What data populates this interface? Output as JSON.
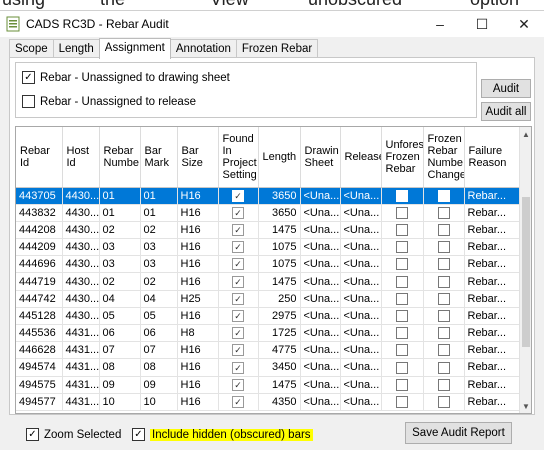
{
  "top_snip": [
    "using",
    "the",
    "View",
    "unobscured",
    "option"
  ],
  "window": {
    "title": "CADS RC3D - Rebar Audit",
    "minimize": "–",
    "maximize": "☐",
    "close": "✕"
  },
  "tabs": [
    "Scope",
    "Length",
    "Assignment",
    "Annotation",
    "Frozen Rebar"
  ],
  "active_tab": "Assignment",
  "options": {
    "unassigned_sheet_label": "Rebar - Unassigned to drawing sheet",
    "unassigned_sheet_checked": true,
    "unassigned_release_label": "Rebar - Unassigned to release",
    "unassigned_release_checked": false
  },
  "buttons": {
    "audit": "Audit",
    "audit_all": "Audit all",
    "save_report": "Save Audit Report"
  },
  "grid": {
    "columns": [
      "Rebar Id",
      "Host Id",
      "Rebar Numbe",
      "Bar Mark",
      "Bar Size",
      "Found In Project Setting",
      "Length",
      "Drawin Sheet",
      "Release",
      "Unfores Frozen Rebar",
      "Frozen Rebar Numbe Change",
      "Failure Reason"
    ],
    "rows": [
      {
        "rebar_id": "443705",
        "host_id": "4430...",
        "rebar_number": "01",
        "bar_mark": "01",
        "bar_size": "H16",
        "length": "3650",
        "sheet": "<Una...",
        "release": "<Una...",
        "reason": "Rebar..."
      },
      {
        "rebar_id": "443832",
        "host_id": "4430...",
        "rebar_number": "01",
        "bar_mark": "01",
        "bar_size": "H16",
        "length": "3650",
        "sheet": "<Una...",
        "release": "<Una...",
        "reason": "Rebar..."
      },
      {
        "rebar_id": "444208",
        "host_id": "4430...",
        "rebar_number": "02",
        "bar_mark": "02",
        "bar_size": "H16",
        "length": "1475",
        "sheet": "<Una...",
        "release": "<Una...",
        "reason": "Rebar..."
      },
      {
        "rebar_id": "444209",
        "host_id": "4430...",
        "rebar_number": "03",
        "bar_mark": "03",
        "bar_size": "H16",
        "length": "1075",
        "sheet": "<Una...",
        "release": "<Una...",
        "reason": "Rebar..."
      },
      {
        "rebar_id": "444696",
        "host_id": "4430...",
        "rebar_number": "03",
        "bar_mark": "03",
        "bar_size": "H16",
        "length": "1075",
        "sheet": "<Una...",
        "release": "<Una...",
        "reason": "Rebar..."
      },
      {
        "rebar_id": "444719",
        "host_id": "4430...",
        "rebar_number": "02",
        "bar_mark": "02",
        "bar_size": "H16",
        "length": "1475",
        "sheet": "<Una...",
        "release": "<Una...",
        "reason": "Rebar..."
      },
      {
        "rebar_id": "444742",
        "host_id": "4430...",
        "rebar_number": "04",
        "bar_mark": "04",
        "bar_size": "H25",
        "length": "250",
        "sheet": "<Una...",
        "release": "<Una...",
        "reason": "Rebar..."
      },
      {
        "rebar_id": "445128",
        "host_id": "4430...",
        "rebar_number": "05",
        "bar_mark": "05",
        "bar_size": "H16",
        "length": "2975",
        "sheet": "<Una...",
        "release": "<Una...",
        "reason": "Rebar..."
      },
      {
        "rebar_id": "445536",
        "host_id": "4431...",
        "rebar_number": "06",
        "bar_mark": "06",
        "bar_size": "H8",
        "length": "1725",
        "sheet": "<Una...",
        "release": "<Una...",
        "reason": "Rebar..."
      },
      {
        "rebar_id": "446628",
        "host_id": "4431...",
        "rebar_number": "07",
        "bar_mark": "07",
        "bar_size": "H16",
        "length": "4775",
        "sheet": "<Una...",
        "release": "<Una...",
        "reason": "Rebar..."
      },
      {
        "rebar_id": "494574",
        "host_id": "4431...",
        "rebar_number": "08",
        "bar_mark": "08",
        "bar_size": "H16",
        "length": "3450",
        "sheet": "<Una...",
        "release": "<Una...",
        "reason": "Rebar..."
      },
      {
        "rebar_id": "494575",
        "host_id": "4431...",
        "rebar_number": "09",
        "bar_mark": "09",
        "bar_size": "H16",
        "length": "1475",
        "sheet": "<Una...",
        "release": "<Una...",
        "reason": "Rebar..."
      },
      {
        "rebar_id": "494577",
        "host_id": "4431...",
        "rebar_number": "10",
        "bar_mark": "10",
        "bar_size": "H16",
        "length": "4350",
        "sheet": "<Una...",
        "release": "<Una...",
        "reason": "Rebar..."
      }
    ]
  },
  "footer": {
    "zoom_selected_label": "Zoom Selected",
    "zoom_selected_checked": true,
    "include_hidden_label": "Include hidden (obscured) bars",
    "include_hidden_checked": true
  },
  "colors": {
    "selection": "#0078d7",
    "highlight": "#ffff00"
  }
}
